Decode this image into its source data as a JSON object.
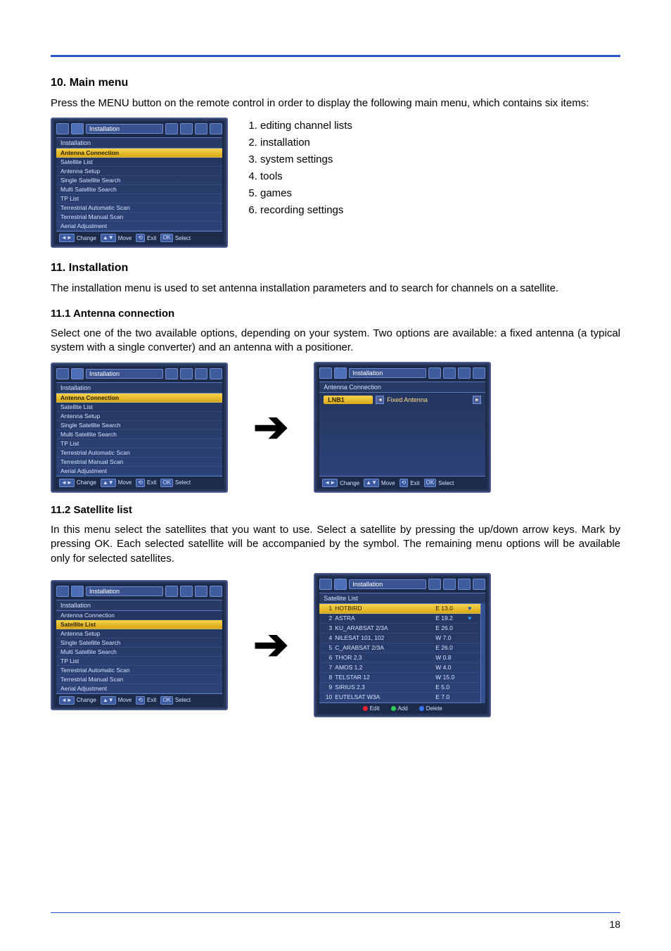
{
  "page_number": "18",
  "sections": {
    "s10": {
      "title": "10. Main menu",
      "para": "Press the MENU button on the remote control in order to display the following main menu, which contains six items:",
      "list": [
        "editing channel lists",
        "installation",
        "system settings",
        "tools",
        "games",
        "recording settings"
      ]
    },
    "s11": {
      "title": "11. Installation",
      "para": "The installation menu is used to set antenna installation parameters and to search for channels on a satellite."
    },
    "s11_1": {
      "title": "11.1 Antenna connection",
      "para": "Select one of the two available options, depending on your system. Two options are available: a fixed antenna (a typical system with a single converter) and an antenna with a positioner."
    },
    "s11_2": {
      "title": "11.2 Satellite list",
      "para": "In this menu select the satellites that you want to use. Select a satellite by pressing the up/down arrow keys. Mark by pressing OK. Each selected satellite will be accompanied by the symbol. The remaining menu options will be available only for selected satellites."
    }
  },
  "screens": {
    "install_menu": {
      "top_title": "Installation",
      "panel_head": "Installation",
      "items": [
        "Antenna Connection",
        "Satellite List",
        "Antenna Setup",
        "Single Satellite Search",
        "Multi Satellite Search",
        "TP List",
        "Terrestrial Automatic Scan",
        "Terrestrial Manual Scan",
        "Aerial Adjustment"
      ],
      "bottom": {
        "b1": "Change",
        "b2": "Move",
        "b3": "Exit",
        "b4": "Select"
      }
    },
    "antenna_conn": {
      "top_title": "Installation",
      "panel_head": "Antenna Connection",
      "label": "LNB1",
      "value": "Fixed Antenna",
      "bottom": {
        "b1": "Change",
        "b2": "Move",
        "b3": "Exit",
        "b4": "Select"
      }
    },
    "install_menu_hl_satlist": {
      "highlight_index": 1
    },
    "sat_list": {
      "top_title": "Installation",
      "panel_head": "Satellite List",
      "rows": [
        {
          "n": "1",
          "name": "HOTBIRD",
          "pos": "E 13.0",
          "mark": true
        },
        {
          "n": "2",
          "name": "ASTRA",
          "pos": "E 19.2",
          "mark": true
        },
        {
          "n": "3",
          "name": "KU_ARABSAT 2/3A",
          "pos": "E 26.0",
          "mark": false
        },
        {
          "n": "4",
          "name": "NILESAT 101, 102",
          "pos": "W 7.0",
          "mark": false
        },
        {
          "n": "5",
          "name": "C_ARABSAT 2/3A",
          "pos": "E 26.0",
          "mark": false
        },
        {
          "n": "6",
          "name": "THOR 2,3",
          "pos": "W 0.8",
          "mark": false
        },
        {
          "n": "7",
          "name": "AMOS 1,2",
          "pos": "W 4.0",
          "mark": false
        },
        {
          "n": "8",
          "name": "TELSTAR 12",
          "pos": "W 15.0",
          "mark": false
        },
        {
          "n": "9",
          "name": "SIRIUS 2,3",
          "pos": "E 5.0",
          "mark": false
        },
        {
          "n": "10",
          "name": "EUTELSAT W3A",
          "pos": "E 7.0",
          "mark": false
        }
      ],
      "bottom": {
        "b1": "Edit",
        "b2": "Add",
        "b3": "Delete"
      }
    }
  }
}
